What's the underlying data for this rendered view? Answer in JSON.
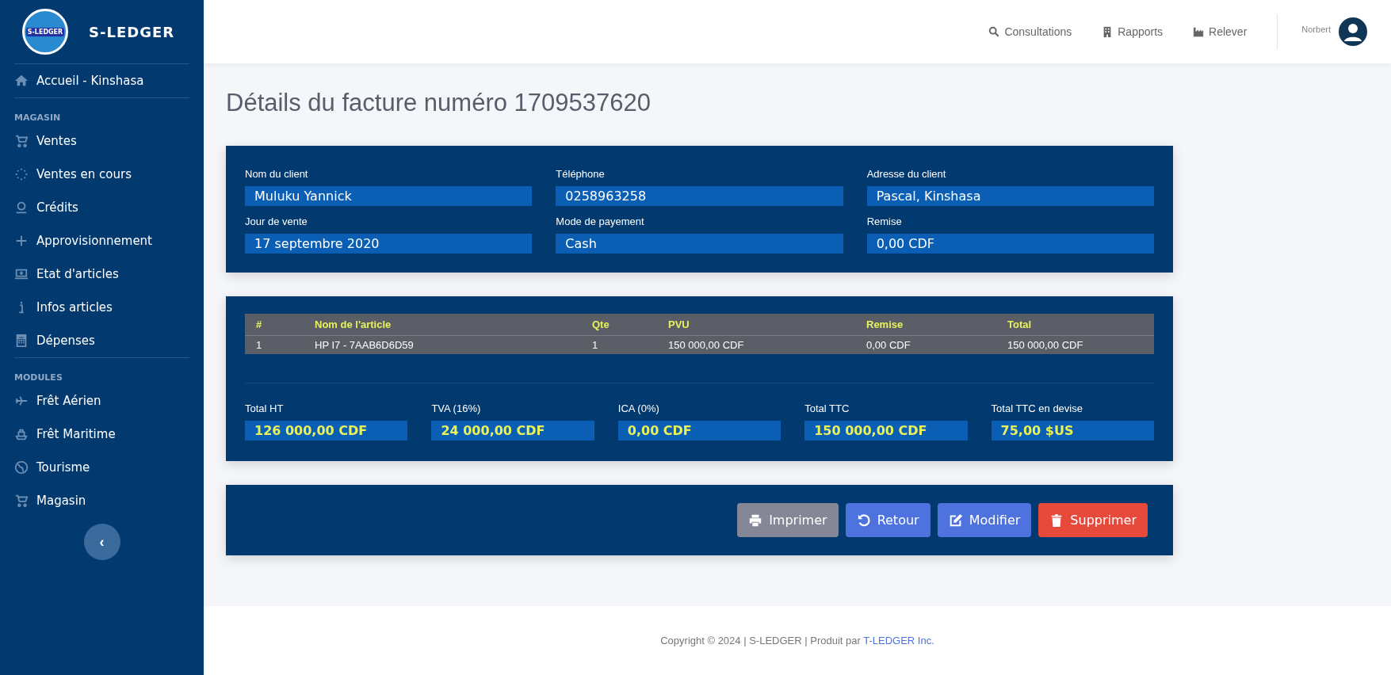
{
  "sidebar": {
    "brand": "S-LEDGER",
    "logo_text": "S-LEDGER",
    "home": "Accueil - Kinshasa",
    "sections": [
      {
        "heading": "MAGASIN",
        "items": [
          "Ventes",
          "Ventes en cours",
          "Crédits",
          "Approvisionnement",
          "Etat d'articles",
          "Infos articles",
          "Dépenses"
        ]
      },
      {
        "heading": "MODULES",
        "items": [
          "Frêt Aérien",
          "Frêt Maritime",
          "Tourisme",
          "Magasin"
        ]
      }
    ],
    "collapse": "‹"
  },
  "topbar": {
    "links": [
      "Consultations",
      "Rapports",
      "Relever"
    ],
    "user": "Norbert"
  },
  "page_title": "Détails du facture numéro 1709537620",
  "invoice": {
    "fields": [
      {
        "label": "Nom du client",
        "value": "Muluku Yannick"
      },
      {
        "label": "Téléphone",
        "value": "0258963258"
      },
      {
        "label": "Adresse du client",
        "value": "Pascal, Kinshasa"
      },
      {
        "label": "Jour de vente",
        "value": "17 septembre 2020"
      },
      {
        "label": "Mode de payement",
        "value": "Cash"
      },
      {
        "label": "Remise",
        "value": "0,00 CDF"
      }
    ]
  },
  "items_table": {
    "columns": [
      "#",
      "Nom de l'article",
      "Qte",
      "PVU",
      "Remise",
      "Total"
    ],
    "rows": [
      [
        "1",
        "HP I7 - 7AAB6D6D59",
        "1",
        "150 000,00 CDF",
        "0,00 CDF",
        "150 000,00 CDF"
      ]
    ]
  },
  "totals": [
    {
      "label": "Total HT",
      "value": "126 000,00 CDF"
    },
    {
      "label": "TVA (16%)",
      "value": "24 000,00 CDF"
    },
    {
      "label": "ICA (0%)",
      "value": "0,00 CDF"
    },
    {
      "label": "Total TTC",
      "value": "150 000,00 CDF"
    },
    {
      "label": "Total TTC en devise",
      "value": "75,00 $US"
    }
  ],
  "actions": [
    {
      "kind": "print",
      "label": "Imprimer"
    },
    {
      "kind": "back",
      "label": "Retour"
    },
    {
      "kind": "edit",
      "label": "Modifier"
    },
    {
      "kind": "delete",
      "label": "Supprimer"
    }
  ],
  "footer": {
    "text": "Copyright © 2024 | S-LEDGER | Produit par",
    "link": "T-LEDGER Inc."
  }
}
